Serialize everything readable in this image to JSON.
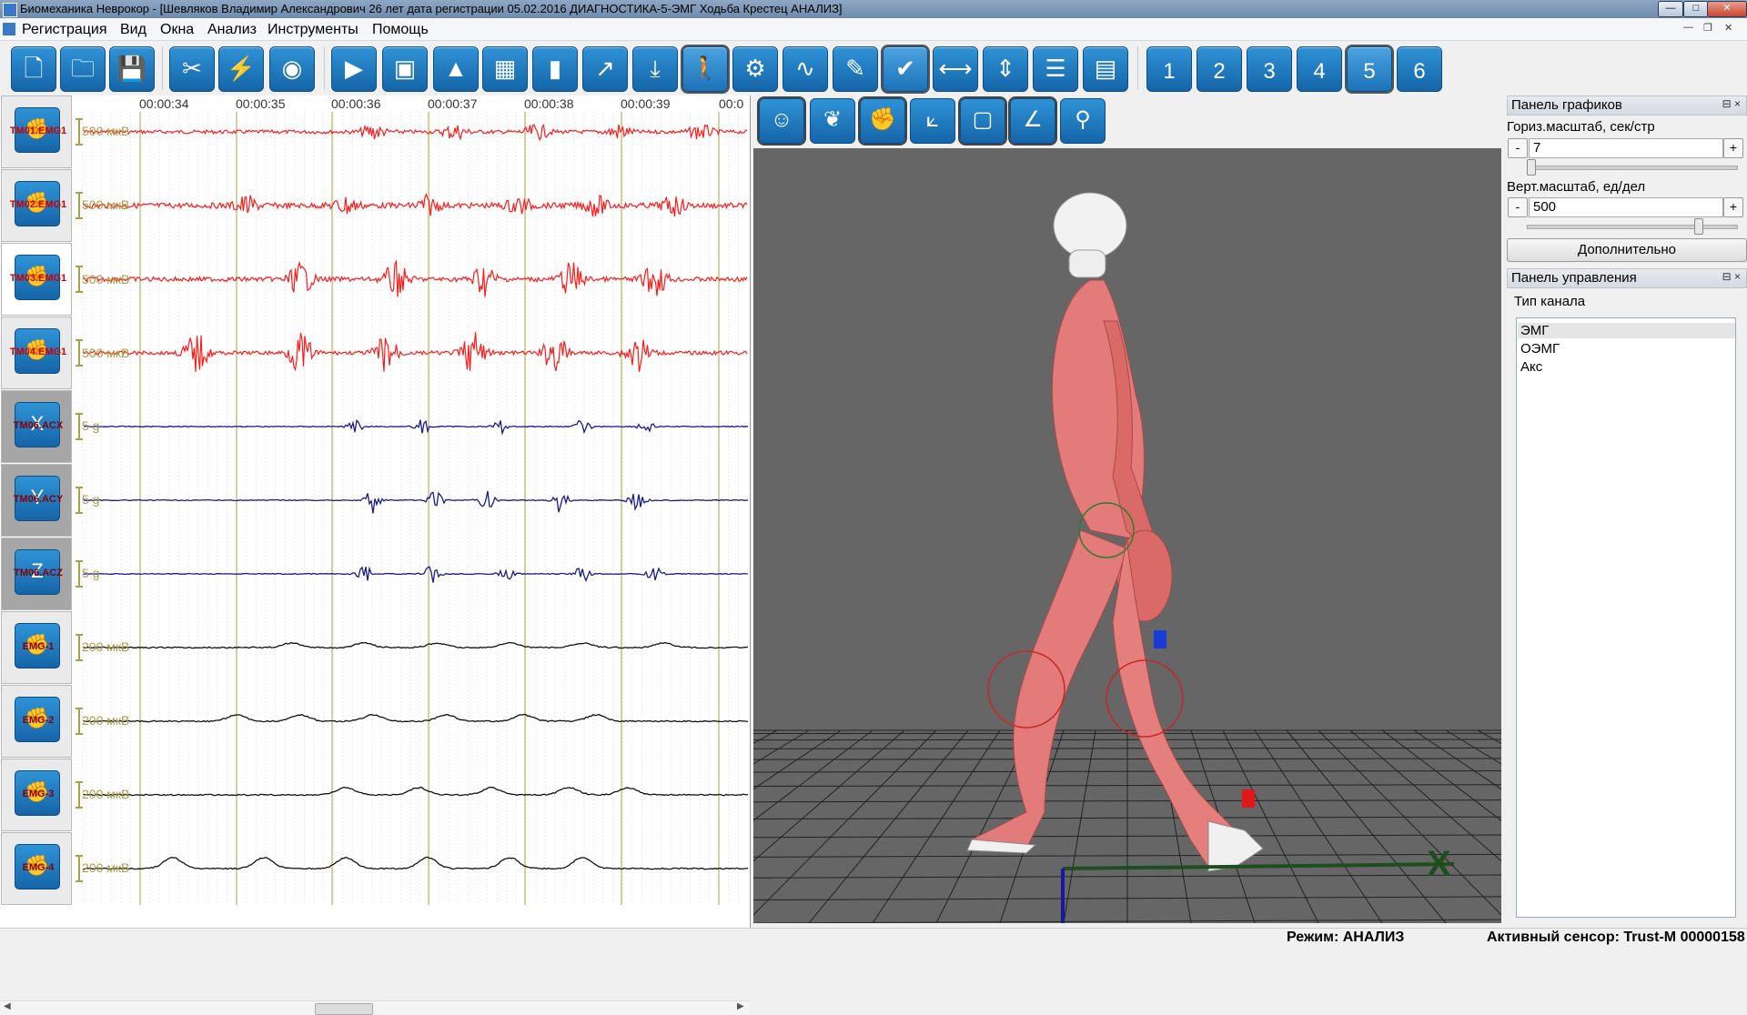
{
  "window": {
    "title": "Биомеханика Неврокор - [Шевляков Владимир Александрович 26 лет дата регистрации  05.02.2016 ДИАГНОСТИКА-5-ЭМГ Ходьба Крестец АНАЛИЗ]",
    "minimize": "—",
    "maximize": "□",
    "close": "✕"
  },
  "menu": {
    "items": [
      "Регистрация",
      "Вид",
      "Окна",
      "Анализ",
      "Инструменты",
      "Помощь"
    ],
    "mdi_minimize": "—",
    "mdi_restore": "❐",
    "mdi_close": "✕"
  },
  "toolbar": {
    "buttons": [
      {
        "icon": "new-document-icon",
        "glyph": "🗋"
      },
      {
        "icon": "open-folder-icon",
        "glyph": "🗀"
      },
      {
        "icon": "save-disk-icon",
        "glyph": "💾"
      },
      {
        "icon": "tools-icon",
        "glyph": "✂"
      },
      {
        "icon": "sensor-signal-icon",
        "glyph": "⚡"
      },
      {
        "icon": "camera-icon",
        "glyph": "◉"
      },
      {
        "icon": "play-icon",
        "glyph": "▶"
      },
      {
        "icon": "monitor-chart-icon",
        "glyph": "▣"
      },
      {
        "icon": "area-chart-icon",
        "glyph": "▲"
      },
      {
        "icon": "table-icon",
        "glyph": "▦"
      },
      {
        "icon": "bar-chart-icon",
        "glyph": "▮"
      },
      {
        "icon": "line-chart-icon",
        "glyph": "↗"
      },
      {
        "icon": "download-icon",
        "glyph": "⤓"
      },
      {
        "icon": "walking-person-icon",
        "glyph": "🚶"
      },
      {
        "icon": "cycling-icon",
        "glyph": "⚙"
      },
      {
        "icon": "curve-icon",
        "glyph": "∿"
      },
      {
        "icon": "pencil-icon",
        "glyph": "✎"
      },
      {
        "icon": "checkmark-icon",
        "glyph": "✔"
      },
      {
        "icon": "horizontal-measure-icon",
        "glyph": "⟷"
      },
      {
        "icon": "amplitude-measure-icon",
        "glyph": "⇕"
      },
      {
        "icon": "report-icon",
        "glyph": "☰"
      },
      {
        "icon": "form-icon",
        "glyph": "▤"
      }
    ],
    "screen_buttons": [
      "1",
      "2",
      "3",
      "4",
      "5",
      "6"
    ]
  },
  "channels": [
    {
      "name": "TM01.EMG1",
      "scale": "500 мкВ"
    },
    {
      "name": "TM02.EMG1",
      "scale": "500 мкВ"
    },
    {
      "name": "TM03.EMG1",
      "scale": "500 мкВ"
    },
    {
      "name": "TM04.EMG1",
      "scale": "500 мкВ"
    },
    {
      "name": "TM06.ACX",
      "scale": "5 g"
    },
    {
      "name": "TM06.ACY",
      "scale": "5 g"
    },
    {
      "name": "TM06.ACZ",
      "scale": "5 g"
    },
    {
      "name": "EMG-1",
      "scale": "200 мкВ"
    },
    {
      "name": "EMG-2",
      "scale": "200 мкВ"
    },
    {
      "name": "EMG-3",
      "scale": "200 мкВ"
    },
    {
      "name": "EMG-4",
      "scale": "200 мкВ"
    }
  ],
  "timeline": [
    "00:00:34",
    "00:00:35",
    "00:00:36",
    "00:00:37",
    "00:00:38",
    "00:00:39",
    "00:0"
  ],
  "colors": {
    "emg_raw": "#ff1a1a",
    "accel": "#1a1a8c",
    "emg_env": "#111111",
    "grid": "#a8a04a",
    "toolbar_button": "#1f7cc2"
  },
  "view3d_toolbar": [
    {
      "icon": "body-figure-icon",
      "glyph": "☺"
    },
    {
      "icon": "lungs-icon",
      "glyph": "❦"
    },
    {
      "icon": "muscle-arm-icon",
      "glyph": "✊"
    },
    {
      "icon": "joint-angles-icon",
      "glyph": "⟀"
    },
    {
      "icon": "frame-icon",
      "glyph": "▢"
    },
    {
      "icon": "angle-icon",
      "glyph": "∠"
    },
    {
      "icon": "ground-marker-icon",
      "glyph": "⚲"
    }
  ],
  "scene": {
    "axis_x_label": "X"
  },
  "graph_panel": {
    "title": "Панель графиков",
    "pin": "⊟ ×",
    "hscale_label": "Гориз.масштаб, сек/стр",
    "hscale_value": "7",
    "vscale_label": "Верт.масштаб, ед/дел",
    "vscale_value": "500",
    "more_button": "Дополнительно",
    "minus": "-",
    "plus": "+"
  },
  "control_panel": {
    "title": "Панель управления",
    "pin": "⊟ ×",
    "channel_type_label": "Тип канала",
    "channel_types": [
      "ЭМГ",
      "ОЭМГ",
      "Акс"
    ],
    "selected_index": 0
  },
  "status": {
    "mode": "Режим: АНАЛИЗ",
    "sensor": "Активный сенсор: Trust-M 00000158"
  }
}
